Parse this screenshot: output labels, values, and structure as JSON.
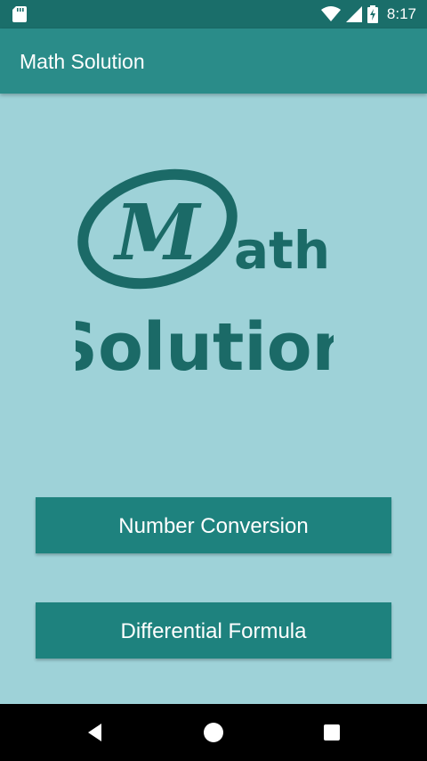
{
  "status_bar": {
    "time": "8:17",
    "icons": [
      "sd-card-icon",
      "wifi-icon",
      "signal-icon",
      "battery-charging-icon"
    ]
  },
  "app_bar": {
    "title": "Math Solution"
  },
  "logo": {
    "initial": "M",
    "rest": "ath",
    "second_line": "Solution",
    "color": "#1b6a67"
  },
  "buttons": {
    "number_conversion": "Number Conversion",
    "differential_formula": "Differential Formula"
  },
  "nav_bar": {
    "icons": [
      "back-icon",
      "home-icon",
      "recents-icon"
    ]
  },
  "colors": {
    "status_bar": "#1a6e6a",
    "app_bar": "#2a8c89",
    "background": "#9ed2d8",
    "button": "#1e827e"
  }
}
